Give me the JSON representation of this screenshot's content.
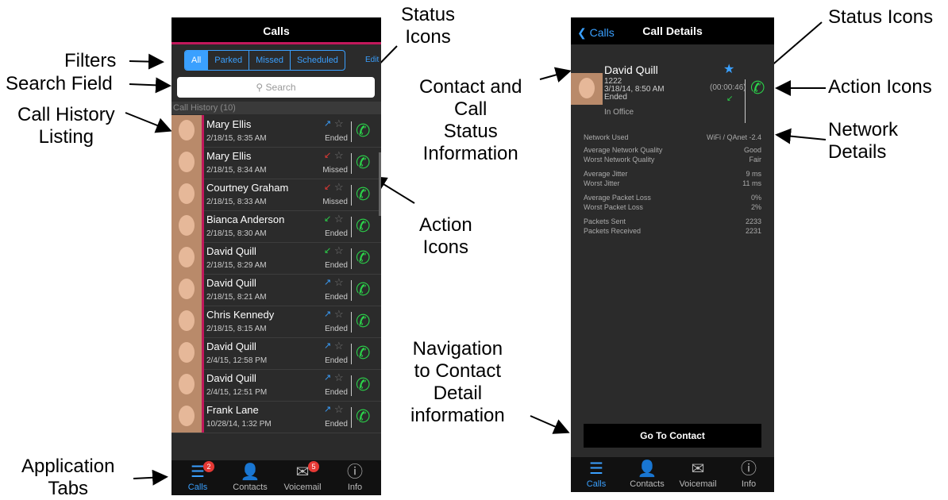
{
  "annotations": {
    "filters": "Filters",
    "search_field": "Search Field",
    "call_history_1": "Call History",
    "call_history_2": "Listing",
    "status_icons_1": "Status",
    "status_icons_2": "Icons",
    "action_icons_1": "Action",
    "action_icons_2": "Icons",
    "application_tabs_1": "Application",
    "application_tabs_2": "Tabs",
    "contact_status_1": "Contact and",
    "contact_status_2": "Call",
    "contact_status_3": "Status",
    "contact_status_4": "Information",
    "navigation_1": "Navigation",
    "navigation_2": "to Contact",
    "navigation_3": "Detail",
    "navigation_4": "information",
    "status_icons_right": "Status Icons",
    "action_icons_right": "Action Icons",
    "network_1": "Network",
    "network_2": "Details"
  },
  "calls_screen": {
    "title": "Calls",
    "filters": [
      "All",
      "Parked",
      "Missed",
      "Scheduled"
    ],
    "edit": "Edit",
    "search_placeholder": "Search",
    "search_icon": "search-icon",
    "history_header": "Call History (10)",
    "rows": [
      {
        "name": "Mary Ellis",
        "date": "2/18/15, 8:35 AM",
        "status": "Ended",
        "dir": "outgoing"
      },
      {
        "name": "Mary Ellis",
        "date": "2/18/15, 8:34 AM",
        "status": "Missed",
        "dir": "missed"
      },
      {
        "name": "Courtney Graham",
        "date": "2/18/15, 8:33 AM",
        "status": "Missed",
        "dir": "missed"
      },
      {
        "name": "Bianca Anderson",
        "date": "2/18/15, 8:30 AM",
        "status": "Ended",
        "dir": "incoming"
      },
      {
        "name": "David Quill",
        "date": "2/18/15, 8:29 AM",
        "status": "Ended",
        "dir": "incoming"
      },
      {
        "name": "David Quill",
        "date": "2/18/15, 8:21 AM",
        "status": "Ended",
        "dir": "outgoing"
      },
      {
        "name": "Chris Kennedy",
        "date": "2/18/15, 8:15 AM",
        "status": "Ended",
        "dir": "outgoing"
      },
      {
        "name": "David Quill",
        "date": "2/4/15, 12:58 PM",
        "status": "Ended",
        "dir": "outgoing"
      },
      {
        "name": "David Quill",
        "date": "2/4/15, 12:51 PM",
        "status": "Ended",
        "dir": "outgoing"
      },
      {
        "name": "Frank Lane",
        "date": "10/28/14, 1:32 PM",
        "status": "Ended",
        "dir": "outgoing"
      }
    ],
    "tabs": [
      {
        "label": "Calls",
        "icon": "list-icon",
        "badge": "2",
        "active": true
      },
      {
        "label": "Contacts",
        "icon": "person-icon",
        "badge": "",
        "active": false
      },
      {
        "label": "Voicemail",
        "icon": "envelope-icon",
        "badge": "5",
        "active": false
      },
      {
        "label": "Info",
        "icon": "info-icon",
        "badge": "",
        "active": false
      }
    ]
  },
  "details_screen": {
    "back_label": "Calls",
    "title": "Call Details",
    "name": "David Quill",
    "number": "1222",
    "datetime": "3/18/14, 8:50 AM",
    "status": "Ended",
    "duration": "(00:00:46)",
    "location": "In Office",
    "network": [
      {
        "label": "Network Used",
        "value": "WiFi / QAnet -2.4"
      },
      {
        "label": "Average Network Quality",
        "value": "Good"
      },
      {
        "label": "Worst Network Quality",
        "value": "Fair"
      },
      {
        "label": "Average Jitter",
        "value": "9 ms"
      },
      {
        "label": "Worst Jitter",
        "value": "11 ms"
      },
      {
        "label": "Average Packet Loss",
        "value": "0%"
      },
      {
        "label": "Worst Packet Loss",
        "value": "2%"
      },
      {
        "label": "Packets Sent",
        "value": "2233"
      },
      {
        "label": "Packets Received",
        "value": "2231"
      }
    ],
    "goto_label": "Go To Contact",
    "tabs": [
      {
        "label": "Calls",
        "icon": "list-icon",
        "active": true
      },
      {
        "label": "Contacts",
        "icon": "person-icon",
        "active": false
      },
      {
        "label": "Voicemail",
        "icon": "envelope-icon",
        "active": false
      },
      {
        "label": "Info",
        "icon": "info-icon",
        "active": false
      }
    ]
  },
  "colors": {
    "accent": "#3aa0ff",
    "call_green": "#2bd44a",
    "missed_red": "#e53935",
    "bar_magenta": "#c2185b"
  }
}
